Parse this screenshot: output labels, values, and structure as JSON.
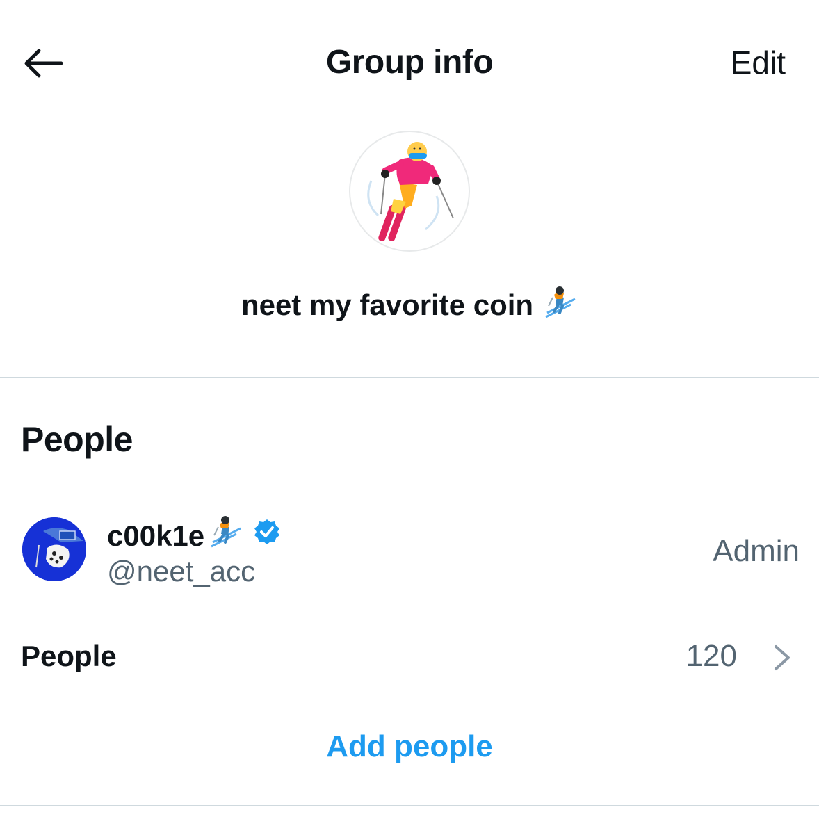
{
  "header": {
    "title": "Group info",
    "edit_label": "Edit",
    "back_icon": "arrow-left-icon"
  },
  "group": {
    "name": "neet my favorite coin",
    "name_emoji": "skier-emoji",
    "avatar_icon": "skier-avatar"
  },
  "people_section": {
    "title": "People",
    "members": [
      {
        "name": "c00k1e",
        "name_emoji": "skier-emoji",
        "verified": true,
        "handle": "@neet_acc",
        "role": "Admin"
      }
    ],
    "people_row": {
      "label": "People",
      "count": "120"
    },
    "add_people_label": "Add people"
  },
  "colors": {
    "text_primary": "#0f1419",
    "text_secondary": "#536471",
    "accent": "#1d9bf0",
    "divider": "#cfd9de",
    "member_avatar_bg": "#1631d6"
  }
}
